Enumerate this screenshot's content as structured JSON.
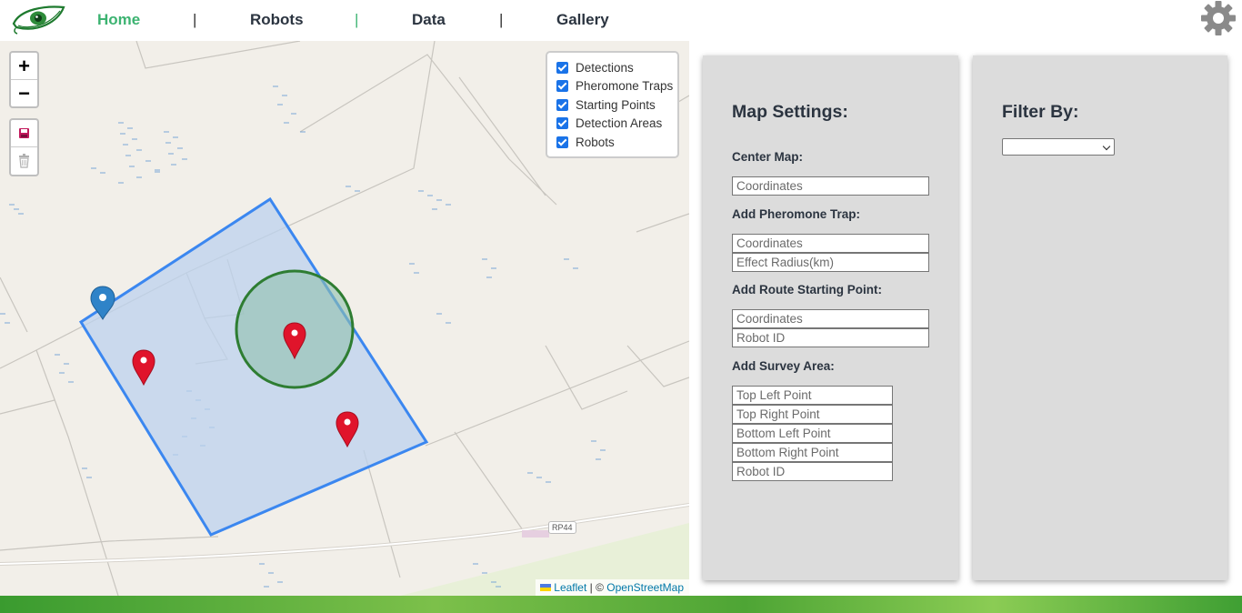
{
  "nav": {
    "home": "Home",
    "robots": "Robots",
    "data": "Data",
    "gallery": "Gallery",
    "separator": "|"
  },
  "colors": {
    "accent_green": "#3cb371",
    "nav_text": "#2b3440",
    "panel_bg": "#dcdcdc",
    "survey_area_stroke": "#3b87f0",
    "survey_area_fill": "#bcd1ee",
    "trap_circle": "#2e7d32",
    "marker_red": "#e0142b",
    "marker_blue": "#2f83c8"
  },
  "map": {
    "zoom_in": "+",
    "zoom_out": "−",
    "controls": [
      "save-icon",
      "trash-icon"
    ],
    "layers": [
      {
        "label": "Detections",
        "checked": true
      },
      {
        "label": "Pheromone Traps",
        "checked": true
      },
      {
        "label": "Starting Points",
        "checked": true
      },
      {
        "label": "Detection Areas",
        "checked": true
      },
      {
        "label": "Robots",
        "checked": true
      }
    ],
    "road_label": "RP44",
    "attribution": {
      "leaflet": "Leaflet",
      "separator": "| ©",
      "osm": "OpenStreetMap"
    }
  },
  "settings": {
    "title": "Map Settings:",
    "center_map": {
      "label": "Center Map:",
      "coordinates_placeholder": "Coordinates"
    },
    "pheromone_trap": {
      "label": "Add Pheromone Trap:",
      "coordinates_placeholder": "Coordinates",
      "radius_placeholder": "Effect Radius(km)"
    },
    "route_start": {
      "label": "Add Route Starting Point:",
      "coordinates_placeholder": "Coordinates",
      "robot_id_placeholder": "Robot ID"
    },
    "survey_area": {
      "label": "Add Survey Area:",
      "top_left_placeholder": "Top Left Point",
      "top_right_placeholder": "Top Right Point",
      "bottom_left_placeholder": "Bottom Left Point",
      "bottom_right_placeholder": "Bottom Right Point",
      "robot_id_placeholder": "Robot ID"
    }
  },
  "filter": {
    "title": "Filter By:",
    "selected": ""
  }
}
